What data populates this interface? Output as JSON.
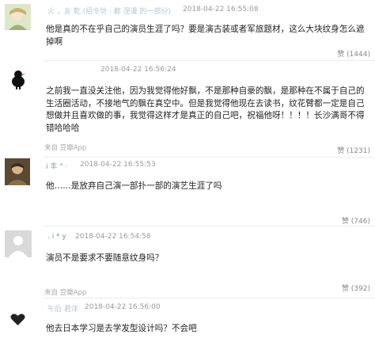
{
  "comments": [
    {
      "username": "火 ，友 乾 (绍令坊 · 都 涅漫 的一部分)",
      "timestamp": "2018-04-22 16:55:08",
      "content": "他是真的不在乎自己的演员生涯了吗？要是演古装或者军旅题材，这么大块纹身怎么遮掉啊",
      "source": "",
      "like_label": "赞 (1444)",
      "avatar_icon": "anime-character-avatar"
    },
    {
      "username": "",
      "timestamp": "2018-04-22 16:56:24",
      "content": "之前我一直没关注他，因为我觉得他好飘，不是那种自豪的飘，是那种在不属于自己的生活圈活动，不接地气的飘在真空中。但是我觉得他现在去读书，纹花臂都一定是自己想做并且喜欢做的事，我觉得这样才是真正的自己吧，祝福他呀！！！！长沙满哥不得错哈哈哈",
      "source": "来自 豆瓣App",
      "like_label": "赞 (1231)",
      "avatar_icon": "black-bird-avatar"
    },
    {
      "username": "i 丰 ° ·",
      "timestamp": "2018-04-22 16:55:53",
      "content": "他……是放弃自己演一部扑一部的演艺生涯了吗",
      "source": "",
      "like_label": "赞 (746)",
      "avatar_icon": "photo-avatar"
    },
    {
      "username": ". i * y",
      "timestamp": "2018-04-22 16:54:58",
      "content": "演员不是要求不要随意纹身吗？",
      "source": "来自 豆瓣App",
      "like_label": "赞 (392)",
      "avatar_icon": "default-user-avatar"
    },
    {
      "username": "午后 君洋",
      "timestamp": "2018-04-22 16:56:00",
      "content": "他去日本学习是去学发型设计吗？不会吧",
      "source": "",
      "like_label": "",
      "avatar_icon": "black-heart-avatar"
    }
  ]
}
